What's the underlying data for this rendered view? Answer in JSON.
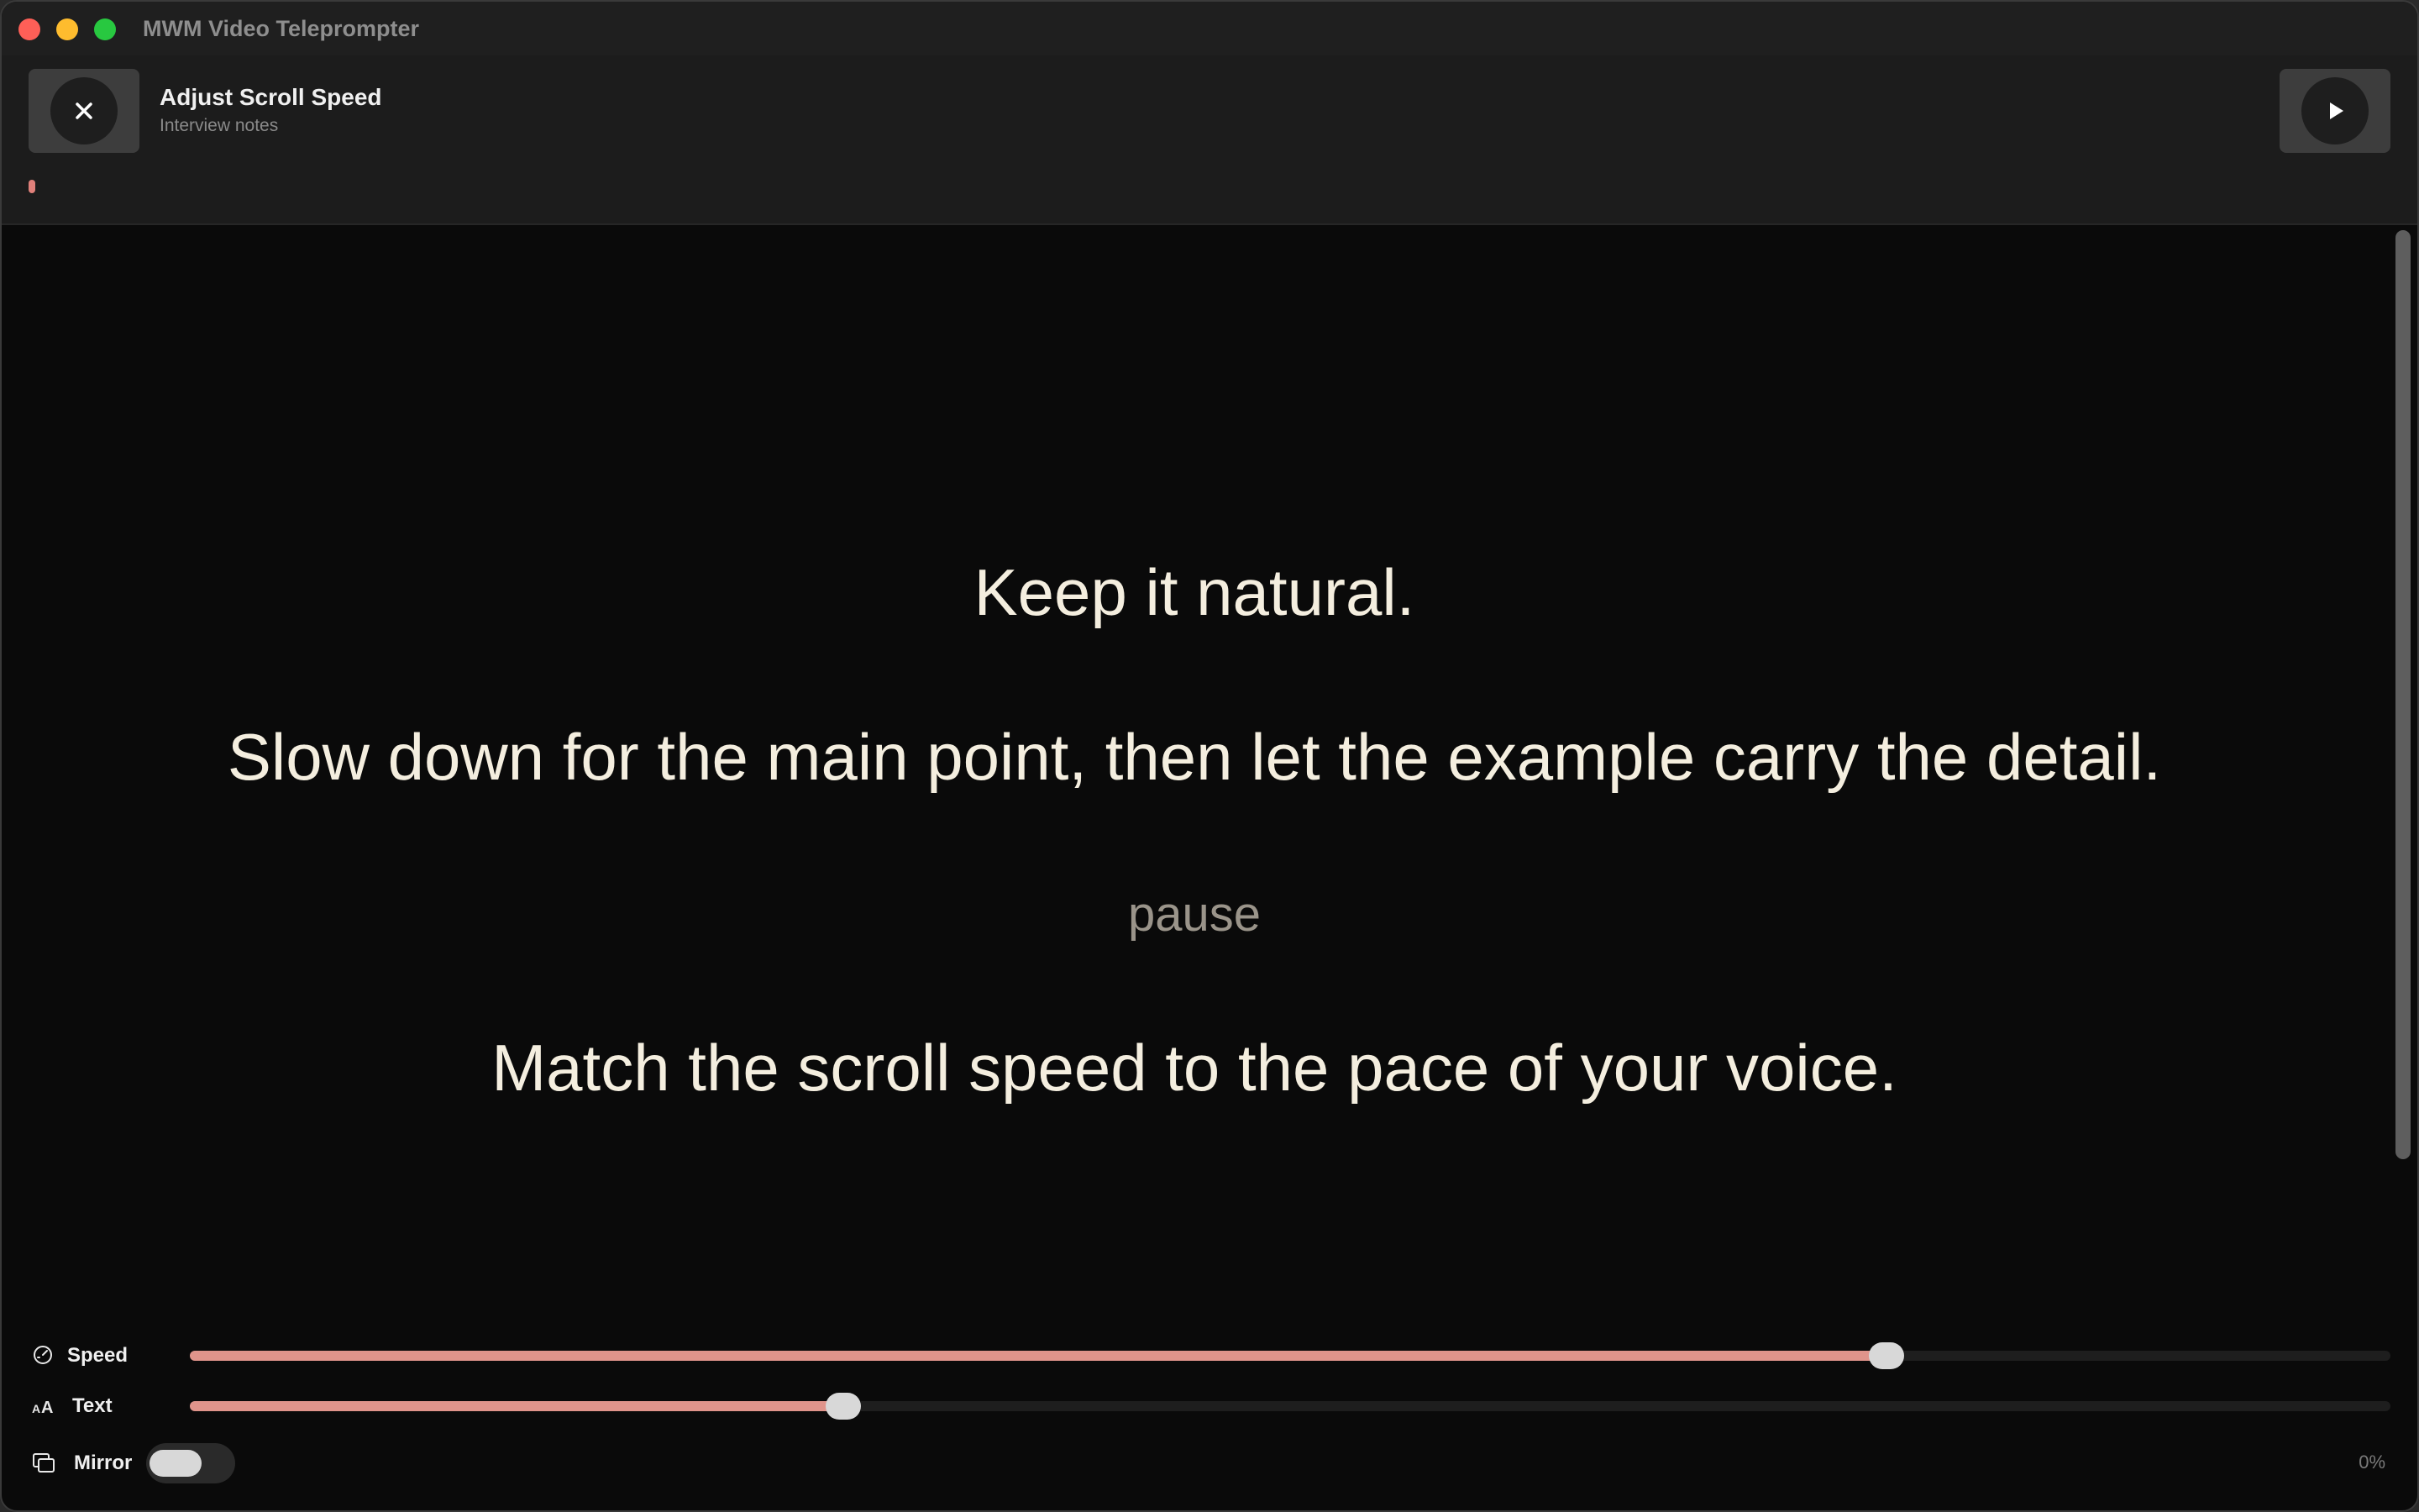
{
  "window": {
    "title": "MWM Video Teleprompter"
  },
  "header": {
    "title": "Adjust Scroll Speed",
    "subtitle": "Interview notes",
    "close_icon": "close-icon",
    "play_icon": "play-icon"
  },
  "script": {
    "lines": [
      {
        "text": "Keep it natural.",
        "kind": "line"
      },
      {
        "text": "Slow down for the main point, then let the example carry the detail.",
        "kind": "line"
      },
      {
        "text": "pause",
        "kind": "cue"
      },
      {
        "text": "Match the scroll speed to the pace of your voice.",
        "kind": "line"
      }
    ]
  },
  "controls": {
    "speed": {
      "label": "Speed",
      "icon": "gauge-icon",
      "value_fraction": 0.771
    },
    "text": {
      "label": "Text",
      "icon": "text-size-icon",
      "value_fraction": 0.297
    },
    "mirror": {
      "label": "Mirror",
      "icon": "mirror-icon",
      "enabled": false
    },
    "progress_label": "0%"
  },
  "colors": {
    "accent": "#e0948b",
    "script_text": "#f4eedf",
    "cue_text": "#9a948a",
    "background": "#0a0a0a"
  }
}
